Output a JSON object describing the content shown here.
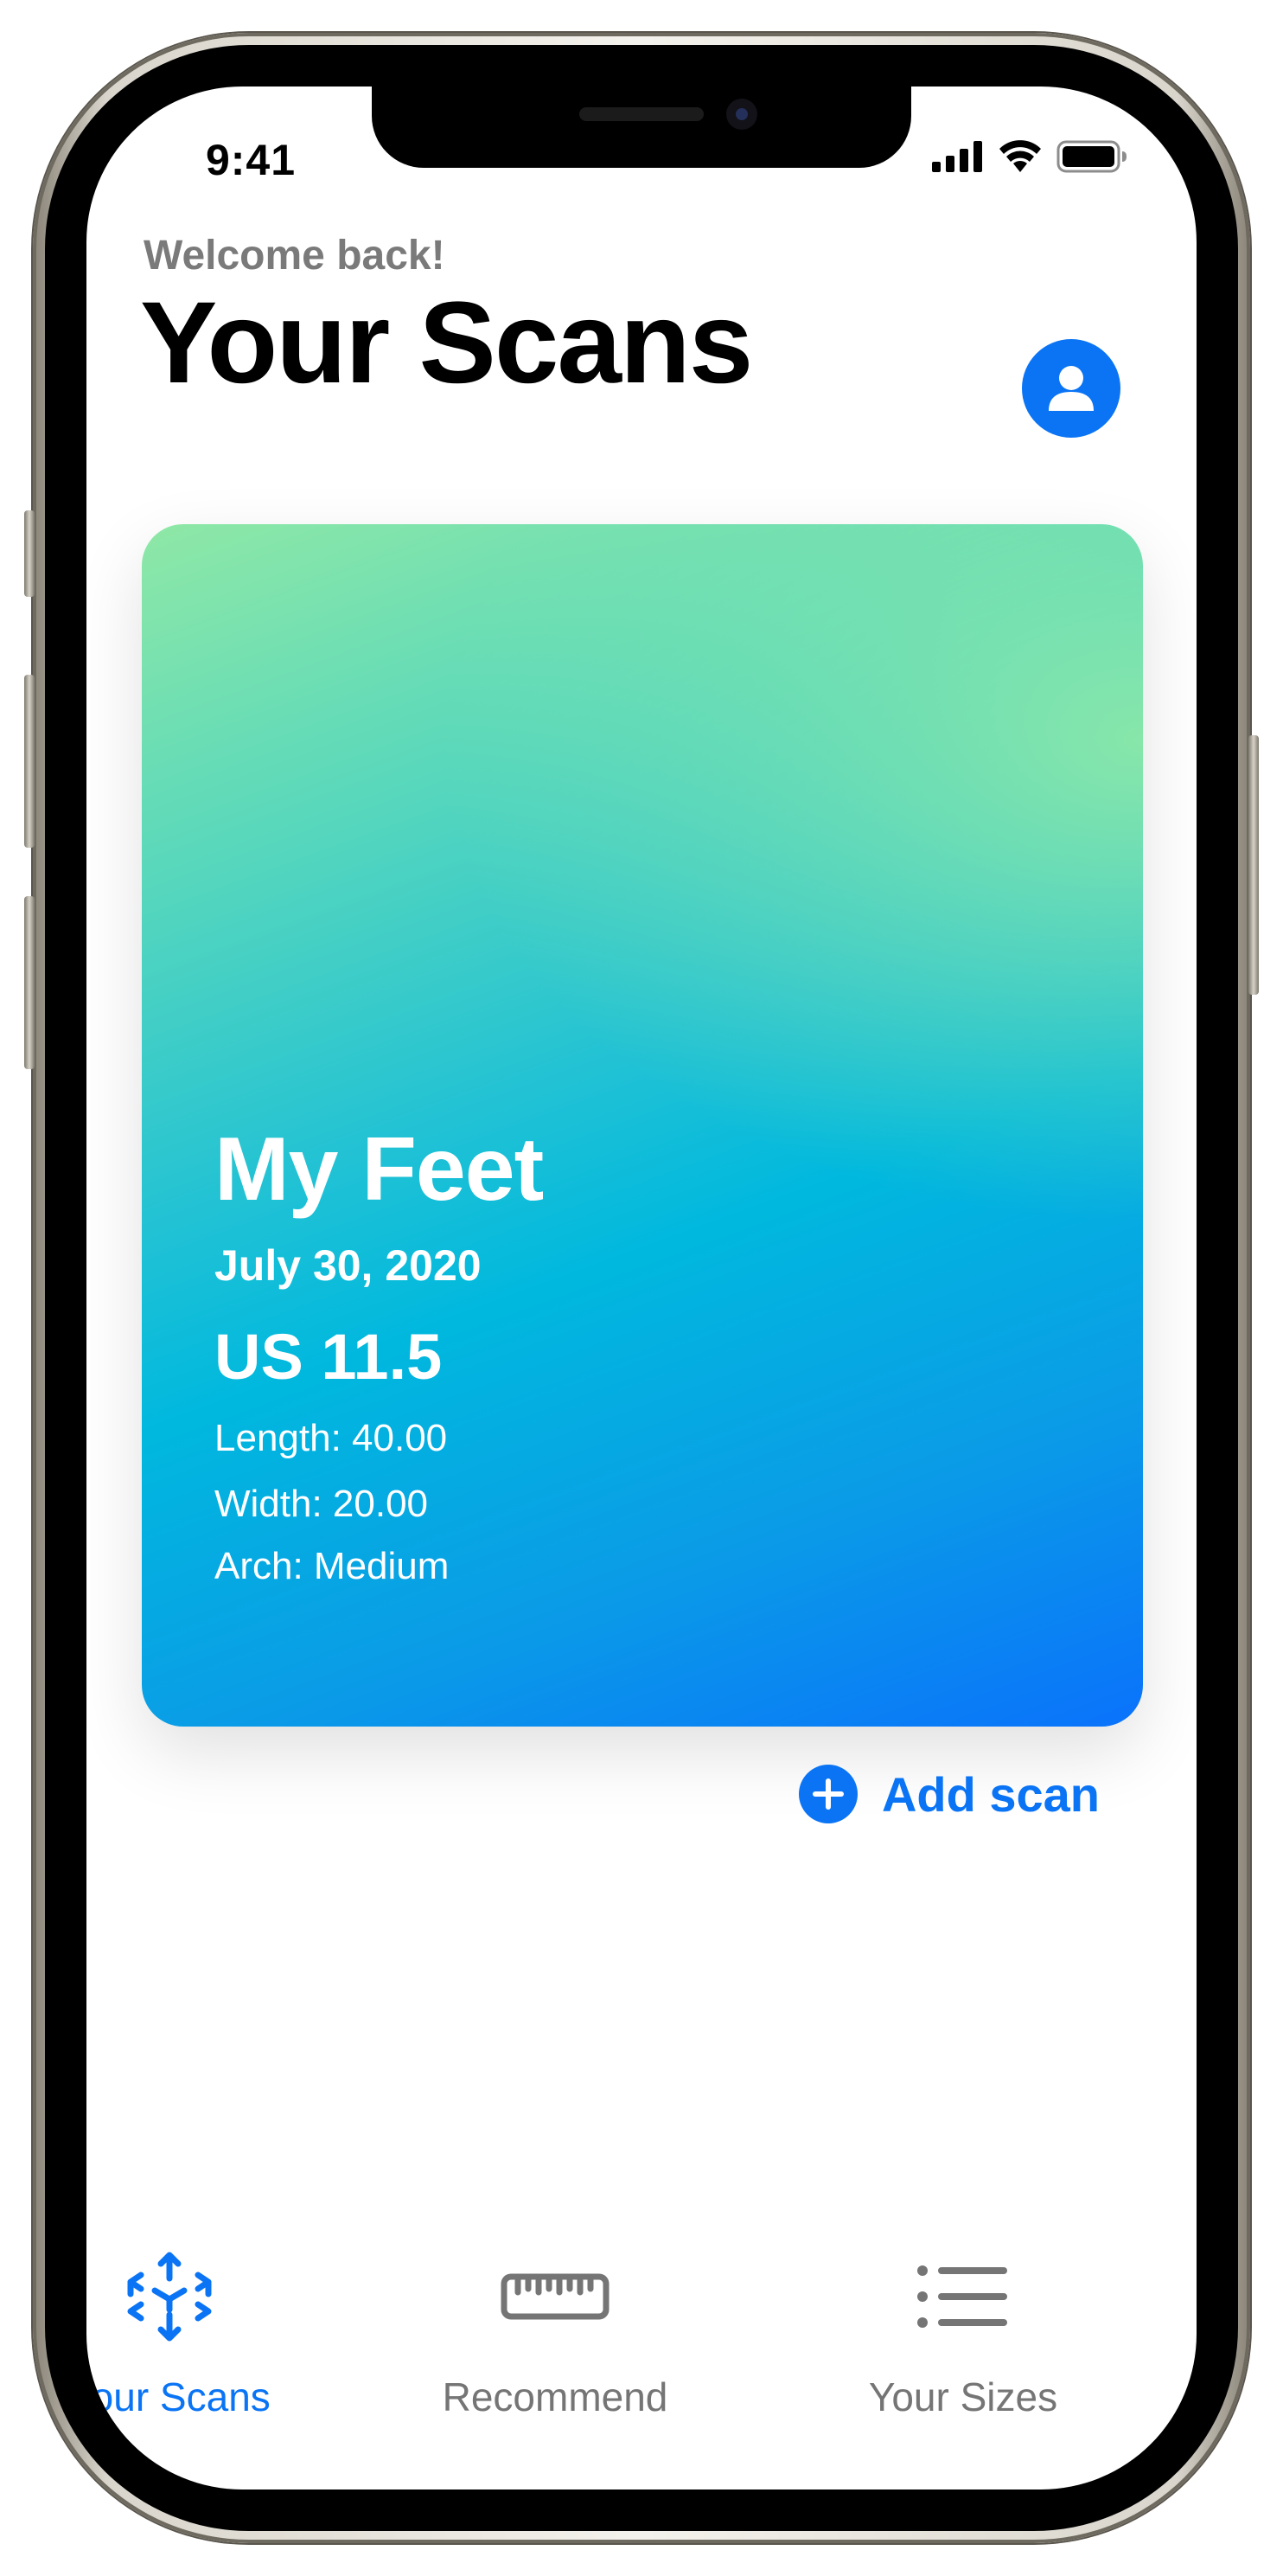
{
  "status_bar": {
    "time": "9:41"
  },
  "header": {
    "welcome": "Welcome back!",
    "title": "Your Scans",
    "profile_icon": "person-circle-icon"
  },
  "scan_card": {
    "name": "My Feet",
    "date": "July 30, 2020",
    "size": "US 11.5",
    "length": "Length: 40.00",
    "width": "Width: 20.00",
    "arch": "Arch: Medium"
  },
  "actions": {
    "add_scan_label": "Add scan"
  },
  "tabs": [
    {
      "label": "Your Scans",
      "icon": "scan-arrows-icon",
      "active": true
    },
    {
      "label": "Recommend",
      "icon": "ruler-icon",
      "active": false
    },
    {
      "label": "Your Sizes",
      "icon": "list-icon",
      "active": false
    }
  ],
  "colors": {
    "accent": "#0a74f5",
    "inactive": "#757575",
    "card_gradient": [
      "#8fe8a6",
      "#00b8de",
      "#0a72fb"
    ]
  }
}
